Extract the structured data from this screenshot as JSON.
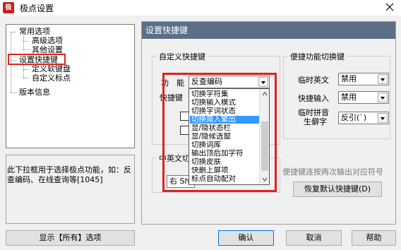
{
  "window": {
    "title": "极点设置",
    "icon": "app-logo-icon"
  },
  "tree": {
    "items": [
      {
        "label": "常用选项"
      },
      {
        "label": "高级选项"
      },
      {
        "label": "其他设置"
      },
      {
        "label": "设置快捷键"
      },
      {
        "label": "定义软键盘"
      },
      {
        "label": "自定义标点"
      },
      {
        "label": "版本信息"
      }
    ]
  },
  "hint": {
    "text": "此下拉框用于选择极点功能，如：反查编码、在线查询等[1045]"
  },
  "panel": {
    "header": "设置快捷键",
    "custom_group": {
      "title": "自定义快捷键",
      "function_label": "功　能",
      "function_value": "反查编码",
      "shortcut_label": "快捷键"
    },
    "dropdown": {
      "items": [
        "切换字符集",
        "切换输入模式",
        "切换字词状态",
        "切换简入繁出",
        "显/隐状态栏",
        "显/隐候选窗",
        "切换词库",
        "输出顶后加字符",
        "切换皮肤",
        "快删上屏项",
        "标点自动配对"
      ],
      "selected_index": 3
    },
    "zh_en_group": {
      "title_partial": "中英文切",
      "value_partial": "右 Sh"
    },
    "quick_group": {
      "title": "便捷功能切换键",
      "rows": [
        {
          "label": "临时英文",
          "value": "禁用"
        },
        {
          "label": "快捷输入",
          "value": "禁用"
        },
        {
          "label": "临时拼音\n生僻字",
          "label_line1": "临时拼音",
          "label_line2": "生僻字",
          "value": "反引(`)"
        }
      ]
    },
    "note": "便捷键连按两次输出对应符号",
    "restore_button": "恢复默认快捷键(D)"
  },
  "buttons": {
    "show_all": "显示【所有】选项",
    "ok": "确认",
    "cancel": "取消",
    "help": "帮助"
  },
  "colors": {
    "panel_header": "#5b7087",
    "highlight": "#3399ff",
    "annotation_red": "#dd2222"
  }
}
